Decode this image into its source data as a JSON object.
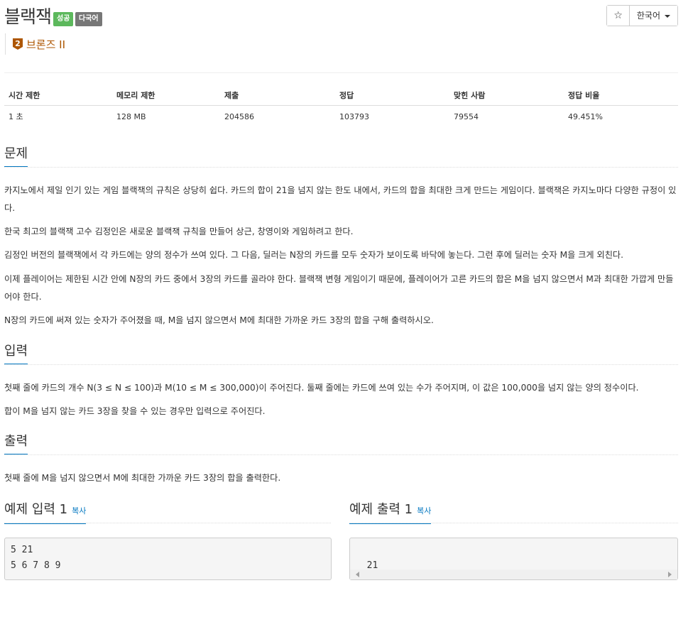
{
  "problem": {
    "title": "블랙잭",
    "badges": [
      "성공",
      "다국어"
    ],
    "tier_number": "2",
    "tier_label": "브론즈 II",
    "star_label": "☆",
    "language": "한국어"
  },
  "stats": {
    "headers": [
      "시간 제한",
      "메모리 제한",
      "제출",
      "정답",
      "맞힌 사람",
      "정답 비율"
    ],
    "values": [
      "1 초",
      "128 MB",
      "204586",
      "103793",
      "79554",
      "49.451%"
    ]
  },
  "sections": {
    "problem_title": "문제",
    "problem_paragraphs": [
      "카지노에서 제일 인기 있는 게임 블랙잭의 규칙은 상당히 쉽다. 카드의 합이 21을 넘지 않는 한도 내에서, 카드의 합을 최대한 크게 만드는 게임이다. 블랙잭은 카지노마다 다양한 규정이 있다.",
      "한국 최고의 블랙잭 고수 김정인은 새로운 블랙잭 규칙을 만들어 상근, 창영이와 게임하려고 한다.",
      "김정인 버전의 블랙잭에서 각 카드에는 양의 정수가 쓰여 있다. 그 다음, 딜러는 N장의 카드를 모두 숫자가 보이도록 바닥에 놓는다. 그런 후에 딜러는 숫자 M을 크게 외친다.",
      "이제 플레이어는 제한된 시간 안에 N장의 카드 중에서 3장의 카드를 골라야 한다. 블랙잭 변형 게임이기 때문에, 플레이어가 고른 카드의 합은 M을 넘지 않으면서 M과 최대한 가깝게 만들어야 한다.",
      "N장의 카드에 써져 있는 숫자가 주어졌을 때, M을 넘지 않으면서 M에 최대한 가까운 카드 3장의 합을 구해 출력하시오."
    ],
    "input_title": "입력",
    "input_paragraphs": [
      "첫째 줄에 카드의 개수 N(3 ≤ N ≤ 100)과 M(10 ≤ M ≤ 300,000)이 주어진다. 둘째 줄에는 카드에 쓰여 있는 수가 주어지며, 이 값은 100,000을 넘지 않는 양의 정수이다.",
      "합이 M을 넘지 않는 카드 3장을 찾을 수 있는 경우만 입력으로 주어진다."
    ],
    "output_title": "출력",
    "output_paragraphs": [
      "첫째 줄에 M을 넘지 않으면서 M에 최대한 가까운 카드 3장의 합을 출력한다."
    ],
    "sample_input_title": "예제 입력 1",
    "sample_output_title": "예제 출력 1",
    "copy_label": "복사",
    "sample_input": "5 21\n5 6 7 8 9",
    "sample_output": "21"
  }
}
